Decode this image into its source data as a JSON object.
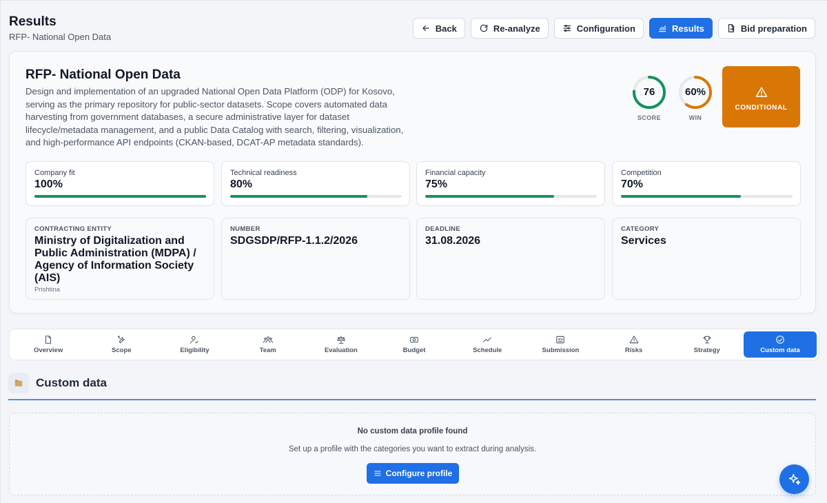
{
  "header": {
    "title": "Results",
    "subtitle": "RFP- National Open Data",
    "buttons": {
      "back": "Back",
      "reanalyze": "Re-analyze",
      "configuration": "Configuration",
      "results": "Results",
      "bid_preparation": "Bid preparation"
    }
  },
  "rfp": {
    "title": "RFP- National Open Data",
    "description": "Design and implementation of an upgraded National Open Data Platform (ODP) for Kosovo, serving as the primary repository for public-sector datasets. Scope covers automated data harvesting from government databases, a secure administrative layer for dataset lifecycle/metadata management, and a public Data Catalog with search, filtering, visualization, and high-performance API endpoints (CKAN-based, DCAT-AP metadata standards).",
    "score": {
      "value": "76",
      "label": "SCORE",
      "percent": 76,
      "color": "#16925b"
    },
    "win": {
      "value": "60%",
      "label": "WIN",
      "percent": 60,
      "color": "#d97706"
    },
    "verdict": {
      "label": "CONDITIONAL",
      "color": "#d97706"
    }
  },
  "metrics": [
    {
      "label": "Company fit",
      "value": "100%",
      "percent": 100
    },
    {
      "label": "Technical readiness",
      "value": "80%",
      "percent": 80
    },
    {
      "label": "Financial capacity",
      "value": "75%",
      "percent": 75
    },
    {
      "label": "Competition",
      "value": "70%",
      "percent": 70
    }
  ],
  "info": {
    "entity": {
      "label": "CONTRACTING ENTITY",
      "value": "Ministry of Digitalization and Public Administration (MDPA) / Agency of Information Society (AIS)",
      "extra": "Prishtina"
    },
    "number": {
      "label": "NUMBER",
      "value": "SDGSDP/RFP-1.1.2/2026"
    },
    "deadline": {
      "label": "DEADLINE",
      "value": "31.08.2026"
    },
    "category": {
      "label": "CATEGORY",
      "value": "Services"
    }
  },
  "tabs": [
    {
      "label": "Overview",
      "icon": "file-icon"
    },
    {
      "label": "Scope",
      "icon": "tools-icon"
    },
    {
      "label": "Eligibility",
      "icon": "user-check-icon"
    },
    {
      "label": "Team",
      "icon": "team-icon"
    },
    {
      "label": "Evaluation",
      "icon": "scale-icon"
    },
    {
      "label": "Budget",
      "icon": "money-icon"
    },
    {
      "label": "Schedule",
      "icon": "trend-icon"
    },
    {
      "label": "Submission",
      "icon": "checklist-icon"
    },
    {
      "label": "Risks",
      "icon": "warning-icon"
    },
    {
      "label": "Strategy",
      "icon": "trophy-icon"
    },
    {
      "label": "Custom data",
      "icon": "custom-icon",
      "active": true
    }
  ],
  "section": {
    "title": "Custom data",
    "empty_title": "No custom data profile found",
    "empty_text": "Set up a profile with the categories you want to extract during analysis.",
    "configure_label": "Configure profile"
  },
  "colors": {
    "accent": "#1f6fe5",
    "success": "#16925b",
    "warning": "#d97706"
  }
}
